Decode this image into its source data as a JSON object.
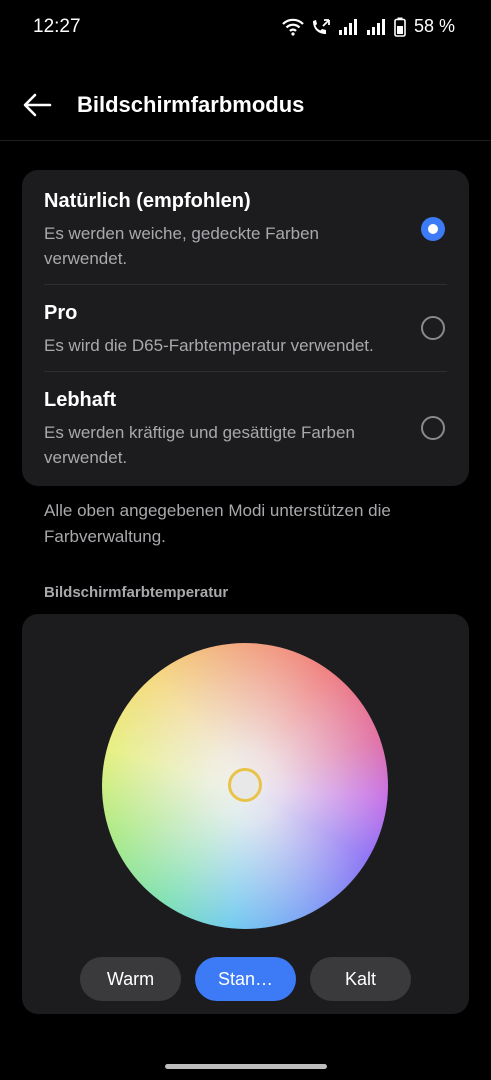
{
  "status": {
    "time": "12:27",
    "battery": "58 %",
    "icons": [
      "wifi-icon",
      "call-icon",
      "signal-icon",
      "signal-icon",
      "battery-icon"
    ]
  },
  "header": {
    "title": "Bildschirmfarbmodus",
    "back_icon": "arrow-left-icon"
  },
  "modes": [
    {
      "title": "Natürlich (empfohlen)",
      "description": "Es werden weiche, gedeckte Farben verwendet.",
      "selected": true
    },
    {
      "title": "Pro",
      "description": "Es wird die D65-Farbtemperatur verwendet.",
      "selected": false
    },
    {
      "title": "Lebhaft",
      "description": "Es werden kräftige und gesättigte Farben verwendet.",
      "selected": false
    }
  ],
  "note": "Alle oben angegebenen Modi unterstützen die Farbverwaltung.",
  "temperature": {
    "section_label": "Bildschirmfarbtemperatur",
    "buttons": [
      {
        "label": "Warm",
        "active": false
      },
      {
        "label": "Stan…",
        "active": true
      },
      {
        "label": "Kalt",
        "active": false
      }
    ]
  },
  "colors": {
    "accent": "#3c7bf5",
    "card": "#1c1c1e",
    "handle_ring": "#e8c34a"
  }
}
